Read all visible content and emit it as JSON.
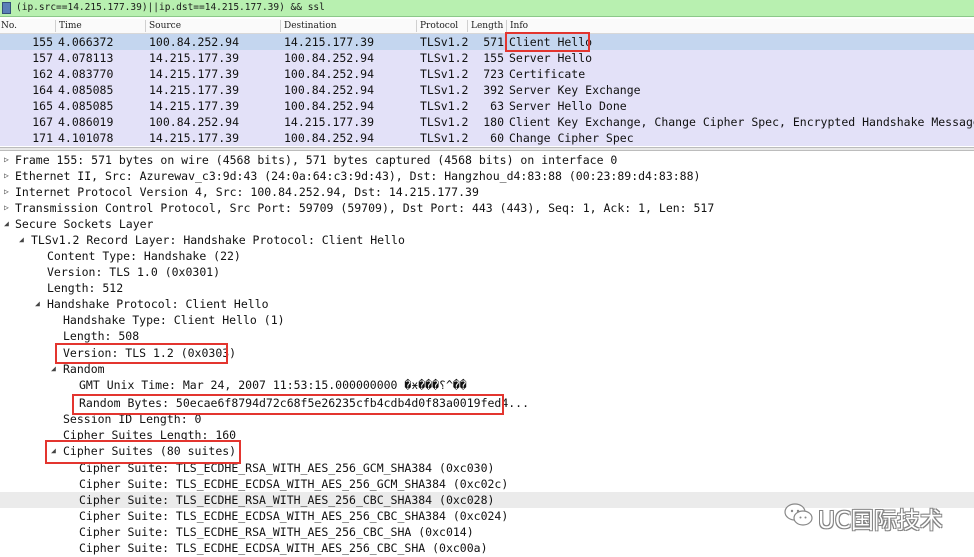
{
  "filter": {
    "text": "(ip.src==14.215.177.39)||ip.dst==14.215.177.39) && ssl"
  },
  "packet_list": {
    "columns": [
      "No.",
      "Time",
      "Source",
      "Destination",
      "Protocol",
      "Length",
      "Info"
    ],
    "rows": [
      {
        "no": "155",
        "time": "4.066372",
        "source": "100.84.252.94",
        "destination": "14.215.177.39",
        "protocol": "TLSv1.2",
        "length": "571",
        "info": "Client Hello"
      },
      {
        "no": "157",
        "time": "4.078113",
        "source": "14.215.177.39",
        "destination": "100.84.252.94",
        "protocol": "TLSv1.2",
        "length": "155",
        "info": "Server Hello"
      },
      {
        "no": "162",
        "time": "4.083770",
        "source": "14.215.177.39",
        "destination": "100.84.252.94",
        "protocol": "TLSv1.2",
        "length": "723",
        "info": "Certificate"
      },
      {
        "no": "164",
        "time": "4.085085",
        "source": "14.215.177.39",
        "destination": "100.84.252.94",
        "protocol": "TLSv1.2",
        "length": "392",
        "info": "Server Key Exchange"
      },
      {
        "no": "165",
        "time": "4.085085",
        "source": "14.215.177.39",
        "destination": "100.84.252.94",
        "protocol": "TLSv1.2",
        "length": "63",
        "info": "Server Hello Done"
      },
      {
        "no": "167",
        "time": "4.086019",
        "source": "100.84.252.94",
        "destination": "14.215.177.39",
        "protocol": "TLSv1.2",
        "length": "180",
        "info": "Client Key Exchange, Change Cipher Spec, Encrypted Handshake Message"
      },
      {
        "no": "171",
        "time": "4.101078",
        "source": "14.215.177.39",
        "destination": "100.84.252.94",
        "protocol": "TLSv1.2",
        "length": "60",
        "info": "Change Cipher Spec"
      }
    ]
  },
  "details": {
    "frame": "Frame 155: 571 bytes on wire (4568 bits), 571 bytes captured (4568 bits) on interface 0",
    "ethernet": "Ethernet II, Src: Azurewav_c3:9d:43 (24:0a:64:c3:9d:43), Dst: Hangzhou_d4:83:88 (00:23:89:d4:83:88)",
    "ip": "Internet Protocol Version 4, Src: 100.84.252.94, Dst: 14.215.177.39",
    "tcp": "Transmission Control Protocol, Src Port: 59709 (59709), Dst Port: 443 (443), Seq: 1, Ack: 1, Len: 517",
    "ssl": "Secure Sockets Layer",
    "record_layer": "TLSv1.2 Record Layer: Handshake Protocol: Client Hello",
    "content_type": "Content Type: Handshake (22)",
    "record_version": "Version: TLS 1.0 (0x0301)",
    "length": "Length: 512",
    "handshake": "Handshake Protocol: Client Hello",
    "handshake_type": "Handshake Type: Client Hello (1)",
    "hs_length": "Length: 508",
    "hs_version": "Version: TLS 1.2 (0x0303)",
    "random": "Random",
    "gmt_time": "GMT Unix Time: Mar 24, 2007 11:53:15.000000000 �ӿ���؟^��",
    "random_bytes": "Random Bytes: 50ecae6f8794d72c68f5e26235cfb4cdb4d0f83a0019fed4...",
    "session_id_length": "Session ID Length: 0",
    "cipher_suites_length": "Cipher Suites Length: 160",
    "cipher_suites": "Cipher Suites (80 suites)",
    "suites": [
      "Cipher Suite: TLS_ECDHE_RSA_WITH_AES_256_GCM_SHA384 (0xc030)",
      "Cipher Suite: TLS_ECDHE_ECDSA_WITH_AES_256_GCM_SHA384 (0xc02c)",
      "Cipher Suite: TLS_ECDHE_RSA_WITH_AES_256_CBC_SHA384 (0xc028)",
      "Cipher Suite: TLS_ECDHE_ECDSA_WITH_AES_256_CBC_SHA384 (0xc024)",
      "Cipher Suite: TLS_ECDHE_RSA_WITH_AES_256_CBC_SHA (0xc014)",
      "Cipher Suite: TLS_ECDHE_ECDSA_WITH_AES_256_CBC_SHA (0xc00a)"
    ]
  },
  "watermark": {
    "text": "UC国际技术"
  },
  "colors": {
    "filter_bg": "#b8f0b0",
    "row_bg": "#e3e1f8",
    "selected_bg": "#c4d6ef",
    "highlight_box": "#e3352f"
  }
}
